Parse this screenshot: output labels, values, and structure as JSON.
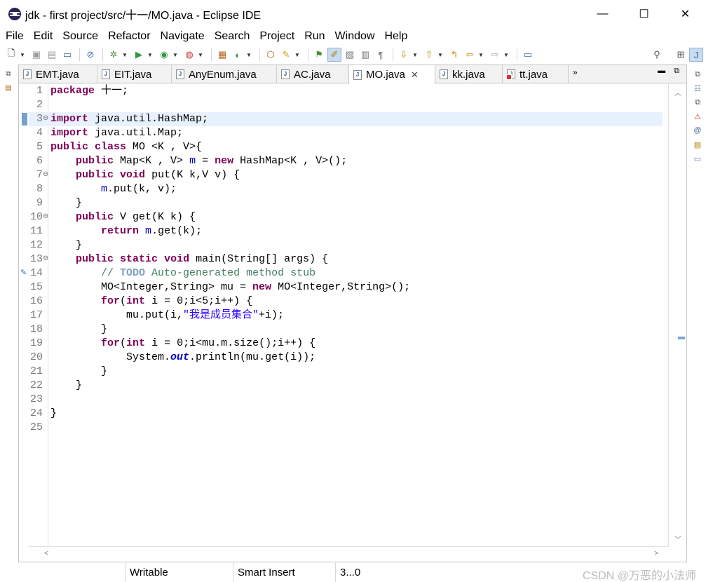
{
  "window": {
    "title": "jdk - first project/src/十一/MO.java - Eclipse IDE",
    "minimize": "—",
    "maximize": "☐",
    "close": "✕"
  },
  "menu": [
    "File",
    "Edit",
    "Source",
    "Refactor",
    "Navigate",
    "Search",
    "Project",
    "Run",
    "Window",
    "Help"
  ],
  "tabs": [
    {
      "label": "EMT.java",
      "active": false,
      "error": false
    },
    {
      "label": "EIT.java",
      "active": false,
      "error": false
    },
    {
      "label": "AnyEnum.java",
      "active": false,
      "error": false
    },
    {
      "label": "AC.java",
      "active": false,
      "error": false
    },
    {
      "label": "MO.java",
      "active": true,
      "error": false
    },
    {
      "label": "kk.java",
      "active": false,
      "error": false
    },
    {
      "label": "tt.java",
      "active": false,
      "error": true
    }
  ],
  "more_tabs": "»",
  "code_lines": [
    "package 十一;",
    "",
    "import java.util.HashMap;",
    "import java.util.Map;",
    "public class MO <K , V>{",
    "    public Map<K , V> m = new HashMap<K , V>();",
    "    public void put(K k,V v) {",
    "        m.put(k, v);",
    "    }",
    "    public V get(K k) {",
    "        return m.get(k);",
    "    }",
    "    public static void main(String[] args) {",
    "        // TODO Auto-generated method stub",
    "        MO<Integer,String> mu = new MO<Integer,String>();",
    "        for(int i = 0;i<5;i++) {",
    "            mu.put(i,\"我是成员集合\"+i);",
    "        }",
    "        for(int i = 0;i<mu.m.size();i++) {",
    "            System.out.println(mu.get(i));",
    "        }",
    "    }",
    "",
    "}",
    ""
  ],
  "status": {
    "writable": "Writable",
    "insert_mode": "Smart Insert",
    "position": "3...0"
  },
  "watermark": "CSDN @万恶的小法师",
  "colors": {
    "keyword": "#7f0055",
    "field": "#0000c0",
    "string": "#2a00ff",
    "comment": "#3f7f5f",
    "current_line": "#e8f2fe"
  }
}
